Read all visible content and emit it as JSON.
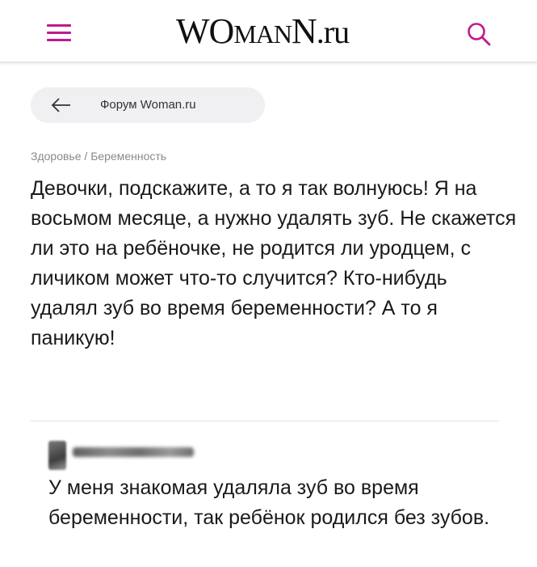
{
  "header": {
    "logo": {
      "cap_w": "W",
      "cap_o": "O",
      "mid_man": "MAN",
      "cap_n": "N",
      "suffix": ".ru"
    },
    "icons": {
      "menu": "hamburger-menu-icon",
      "search": "search-icon"
    },
    "accent_color": "#c2188f"
  },
  "nav": {
    "back_label": "Форум Woman.ru",
    "back_icon": "arrow-left-icon"
  },
  "breadcrumb": {
    "section": "Здоровье",
    "separator": " / ",
    "subsection": "Беременность"
  },
  "question": {
    "text": "Девочки, подскажите, а то я так волнуюсь! Я на восьмом месяце, а нужно удалять зуб. Не скажется ли это на ребёночке, не родится ли уродцем, с личиком может что-то случится? Кто-нибудь удалял зуб во время беременности? А то я паникую!"
  },
  "answer": {
    "text": "У меня знакомая удаляла зуб во время беременности, так ребёнок родился без зубов."
  }
}
